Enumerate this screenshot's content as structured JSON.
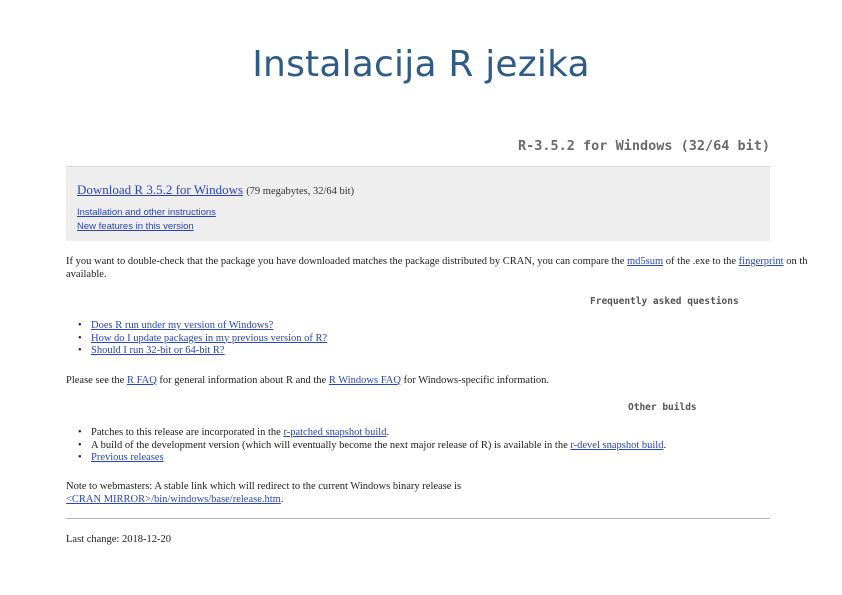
{
  "slide": {
    "title": "Instalacija R jezika"
  },
  "page": {
    "heading": "R-3.5.2 for Windows (32/64 bit)",
    "download": {
      "link_label": "Download R 3.5.2 for Windows",
      "meta": "(79 megabytes, 32/64 bit)",
      "links": [
        "Installation and other instructions",
        "New features in this version"
      ]
    },
    "md5": {
      "text1": "If you want to double-check that the package you have downloaded matches the package distributed by CRAN, you can compare the ",
      "link1": "md5sum",
      "text2": " of the .exe to the ",
      "link2": "fingerprint",
      "text3": " on th",
      "line2": "available."
    },
    "faq": {
      "heading": "Frequently asked questions",
      "items": [
        "Does R run under my version of Windows?",
        "How do I update packages in my previous version of R?",
        "Should I run 32-bit or 64-bit R?"
      ]
    },
    "faq_para": {
      "text1": "Please see the ",
      "link1": "R FAQ",
      "text2": " for general information about R and the ",
      "link2": "R Windows FAQ",
      "text3": " for Windows-specific information."
    },
    "builds": {
      "heading": "Other builds",
      "item1_text": "Patches to this release are incorporated in the ",
      "item1_link": "r-patched snapshot build",
      "item1_end": ".",
      "item2_text": "A build of the development version (which will eventually become the next major release of R) is available in the ",
      "item2_link": "r-devel snapshot build",
      "item2_end": ".",
      "item3_link": "Previous releases"
    },
    "webmasters": {
      "line1": "Note to webmasters: A stable link which will redirect to the current Windows binary release is",
      "link": "<CRAN MIRROR>/bin/windows/base/release.htm",
      "end": "."
    },
    "last_change": "Last change: 2018-12-20"
  },
  "colors": {
    "title": "#2f5b87",
    "link": "#2b46b8",
    "box_bg": "#eeeeee"
  }
}
